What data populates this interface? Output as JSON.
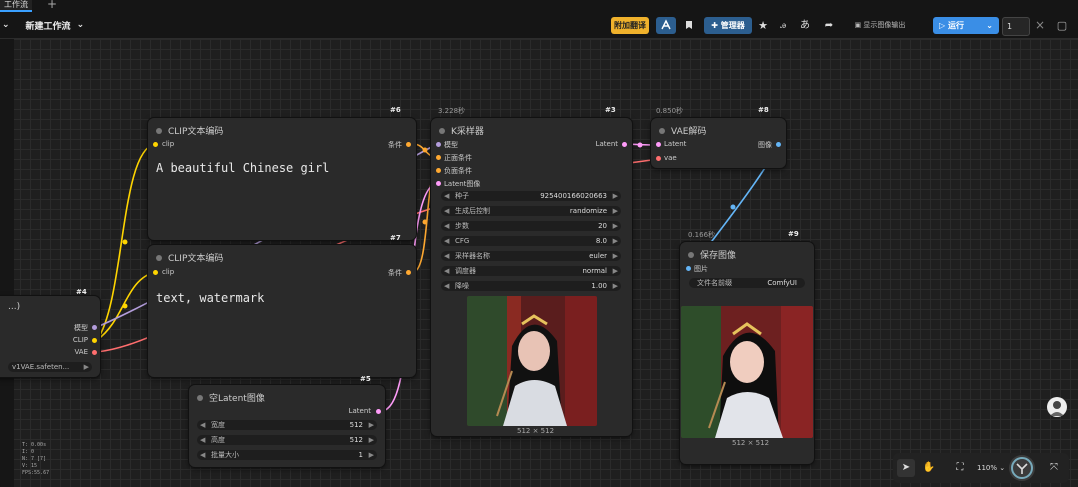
{
  "tabs": {
    "active": "工作流",
    "add": "+"
  },
  "workflow_menu": {
    "label": "新建工作流",
    "caret": "⌄",
    "left_caret": "⌄"
  },
  "toolbar": {
    "translate": "附加翻译",
    "manager": "管理器",
    "show_image": "显示图像输出",
    "run": "运行",
    "run_caret": "⌄",
    "queue_count": "1",
    "close": "×",
    "panel": "▢"
  },
  "nodes": {
    "clip1": {
      "id": "#6",
      "title": "CLIP文本编码",
      "input": "clip",
      "output": "条件",
      "text": "A beautiful Chinese girl"
    },
    "clip2": {
      "id": "#7",
      "title": "CLIP文本编码",
      "input": "clip",
      "output": "条件",
      "text": "text, watermark"
    },
    "ksampler": {
      "id": "#3",
      "time": "3.228秒",
      "title": "K采样器",
      "inputs": [
        "模型",
        "正面条件",
        "负面条件",
        "Latent图像"
      ],
      "output": "Latent",
      "widgets": [
        {
          "label": "种子",
          "value": "925400166020663"
        },
        {
          "label": "生成后控制",
          "value": "randomize"
        },
        {
          "label": "步数",
          "value": "20"
        },
        {
          "label": "CFG",
          "value": "8.0"
        },
        {
          "label": "采样器名称",
          "value": "euler"
        },
        {
          "label": "调度器",
          "value": "normal"
        },
        {
          "label": "降噪",
          "value": "1.00"
        }
      ],
      "image_size": "512 × 512"
    },
    "vae": {
      "id": "#8",
      "time": "0.850秒",
      "title": "VAE解码",
      "inputs": [
        "Latent",
        "vae"
      ],
      "output": "图像"
    },
    "save": {
      "id": "#9",
      "time": "0.166秒",
      "title": "保存图像",
      "input": "图片",
      "prefix_label": "文件名前缀",
      "prefix_value": "ComfyUI",
      "image_size": "512 × 512"
    },
    "checkpoint": {
      "id": "#4",
      "title": "...)",
      "outputs": [
        "模型",
        "CLIP",
        "VAE"
      ],
      "widget": "v1VAE.safeten..."
    },
    "latent": {
      "id": "#5",
      "title": "空Latent图像",
      "output": "Latent",
      "widgets": [
        {
          "label": "宽度",
          "value": "512"
        },
        {
          "label": "高度",
          "value": "512"
        },
        {
          "label": "批量大小",
          "value": "1"
        }
      ]
    }
  },
  "stats": [
    "T: 0.00s",
    "I: 0",
    "N: 7 [7]",
    "V: 15",
    "FPS:55.67"
  ],
  "zoom": {
    "label": "110%",
    "caret": "⌄"
  },
  "colors": {
    "accent": "#3a8ee6",
    "clip": "#ffd500",
    "model": "#b39ddb",
    "conditioning": "#ffa931",
    "latent": "#ff9cf9",
    "vae": "#ff6e6e",
    "image": "#64b5f6",
    "translate": "#f0b22c"
  },
  "icons": [
    "bookmark-icon",
    "puzzle-icon",
    "star-icon",
    "font-icon",
    "translate-icon",
    "share-icon",
    "image-icon",
    "play-icon",
    "close-icon",
    "panel-icon",
    "pointer-icon",
    "hand-icon",
    "fit-icon",
    "logo-icon",
    "focus-icon",
    "avatar-icon"
  ]
}
